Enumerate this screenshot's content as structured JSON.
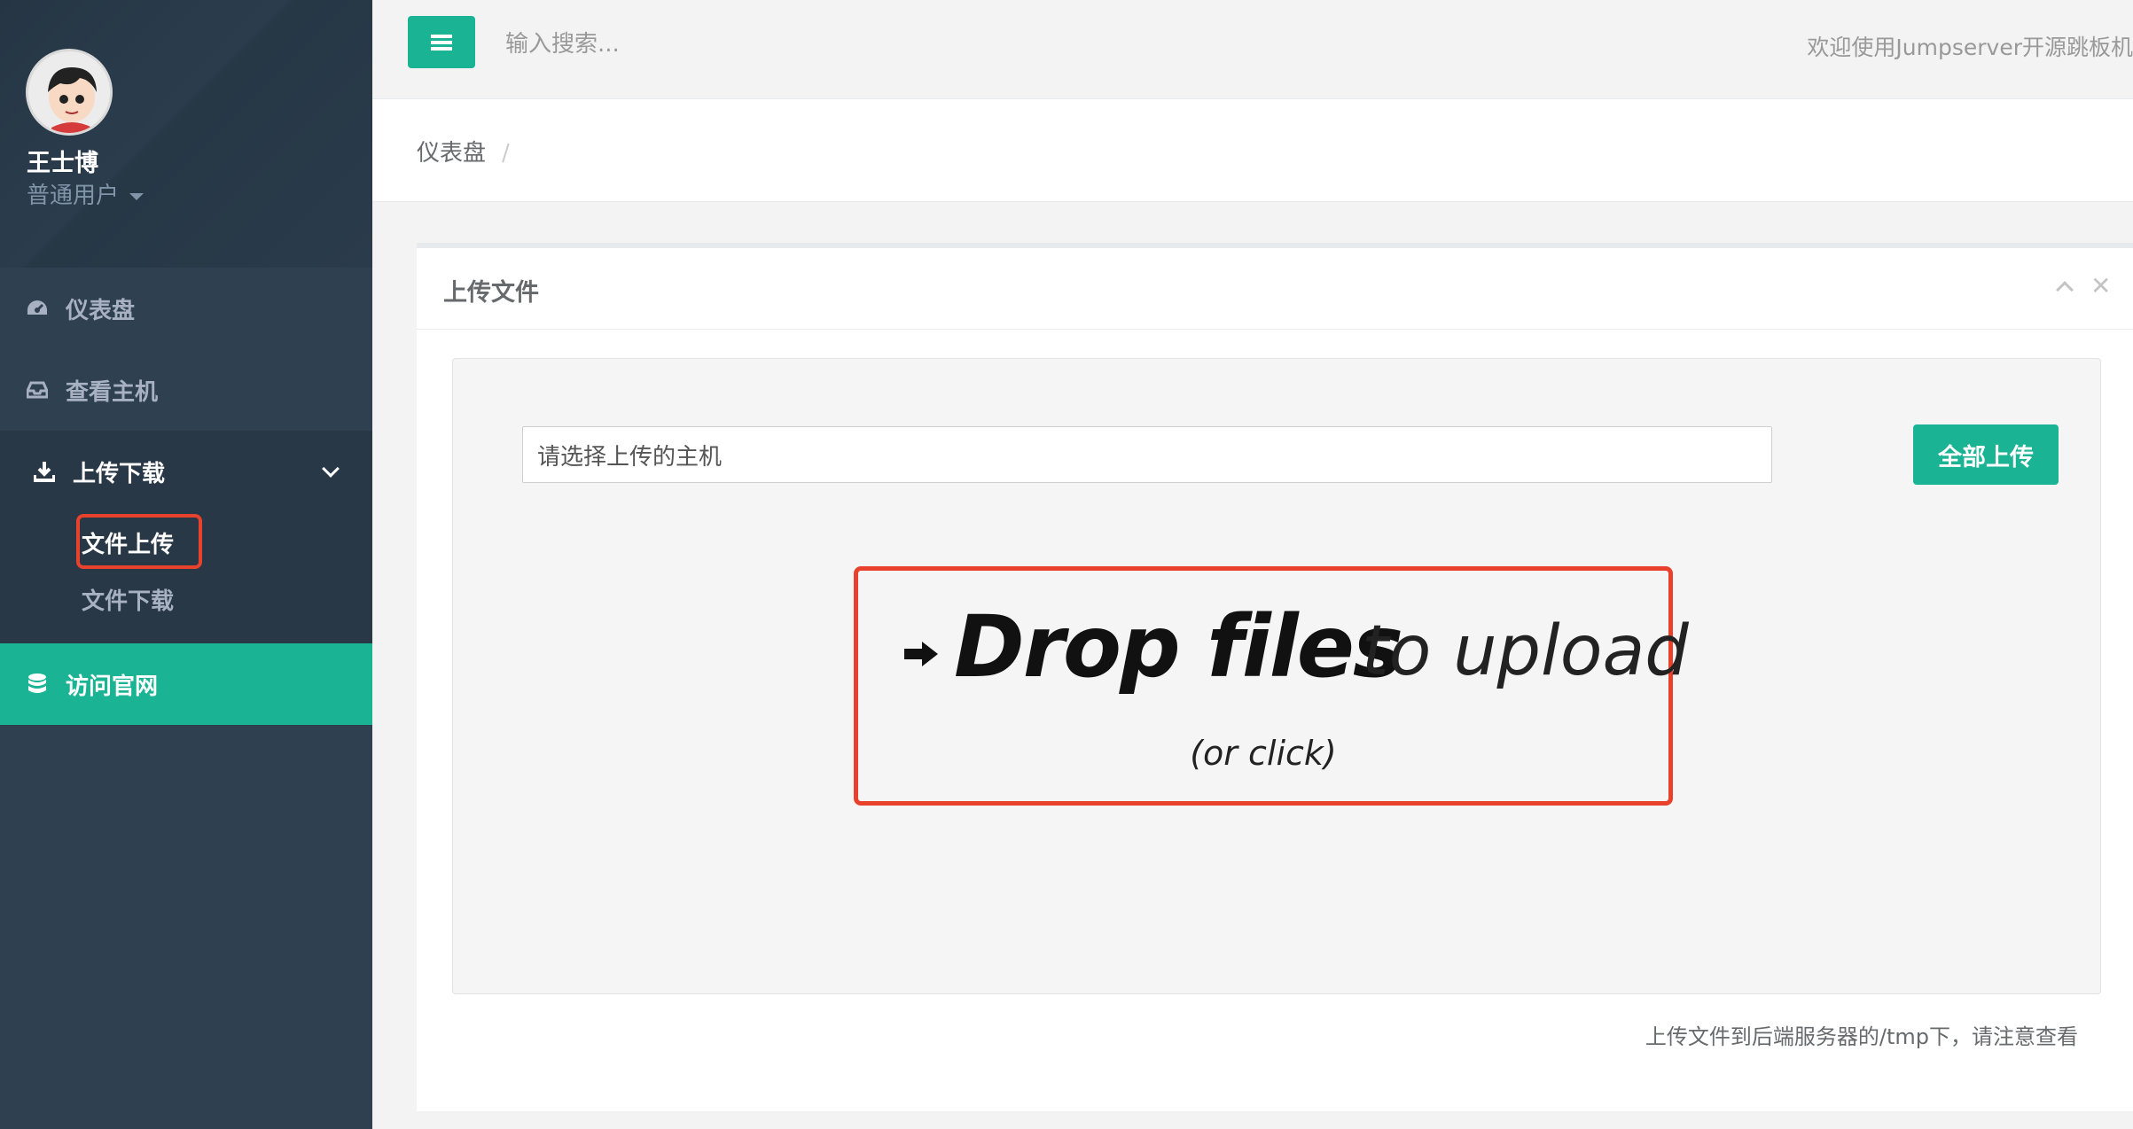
{
  "sidebar": {
    "profile": {
      "name": "王士博",
      "role": "普通用户"
    },
    "items": [
      {
        "label": "仪表盘",
        "icon": "dashboard-icon"
      },
      {
        "label": "查看主机",
        "icon": "inbox-icon"
      },
      {
        "label": "上传下载",
        "icon": "download-icon"
      },
      {
        "label": "访问官网",
        "icon": "database-icon"
      }
    ],
    "sub_items": [
      {
        "label": "文件上传",
        "selected": true
      },
      {
        "label": "文件下载",
        "selected": false
      }
    ]
  },
  "topbar": {
    "search_placeholder": "输入搜索...",
    "welcome": "欢迎使用Jumpserver开源跳板机"
  },
  "breadcrumb": {
    "item": "仪表盘",
    "separator": "/"
  },
  "panel": {
    "title": "上传文件",
    "host_select_placeholder": "请选择上传的主机",
    "upload_all_label": "全部上传",
    "dropzone": {
      "main": "Drop files",
      "secondary": "to upload",
      "sub": "(or click)"
    },
    "note": "上传文件到后端服务器的/tmp下，请注意查看"
  },
  "colors": {
    "sidebar": "#2f4050",
    "accent": "#1ab394",
    "highlight": "#e8412c"
  }
}
